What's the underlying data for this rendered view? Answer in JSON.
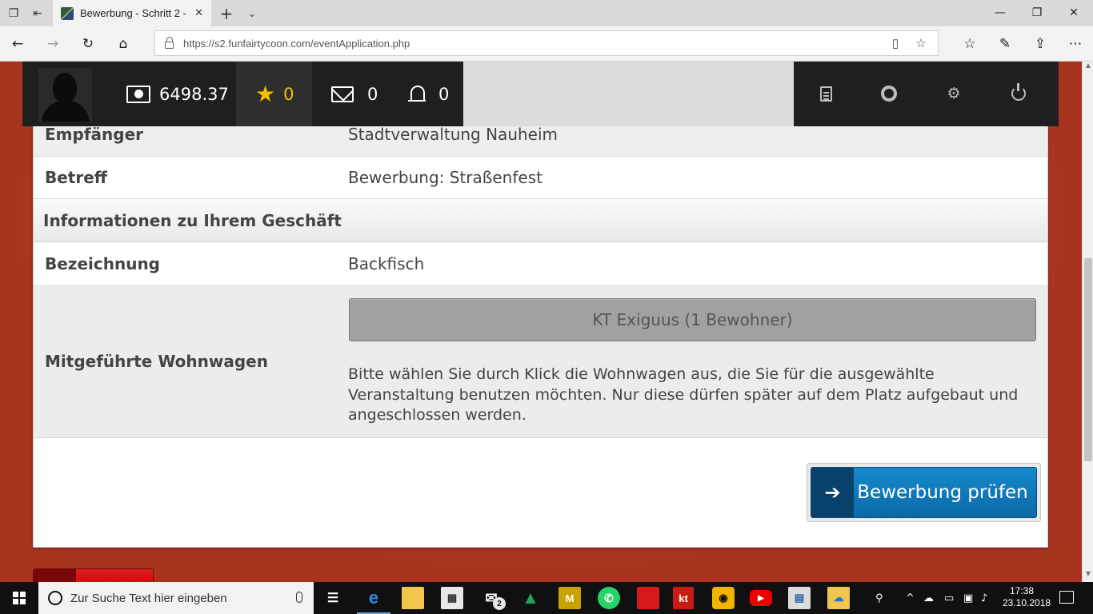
{
  "browser": {
    "tab_title": "Bewerbung - Schritt 2 -",
    "url": "https://s2.funfairtycoon.com/eventApplication.php",
    "icons": [
      "task-view-icon",
      "set-aside-icon",
      "close-icon",
      "new-tab-icon",
      "chevron-down-icon",
      "back-icon",
      "forward-icon",
      "refresh-icon",
      "home-icon",
      "lock-icon",
      "reading-view-icon",
      "favorite-star-icon",
      "favorites-hub-icon",
      "pen-icon",
      "share-icon",
      "more-icon"
    ]
  },
  "window_controls": [
    "minimize-icon",
    "restore-icon",
    "close-icon"
  ],
  "gamebar": {
    "money": "6498.37",
    "favorites": "0",
    "messages": "0",
    "notifications": "0",
    "colors": {
      "bar": "#1f1f1f",
      "favorites_accent": "#f2c200"
    },
    "menu_icons": [
      "document-icon",
      "help-lifebuoy-icon",
      "settings-gears-icon",
      "power-icon"
    ]
  },
  "form": {
    "recipient": {
      "label": "Empfänger",
      "value": "Stadtverwaltung Nauheim"
    },
    "subject": {
      "label": "Betreff",
      "value": "Bewerbung: Straßenfest"
    },
    "section_title": "Informationen zu Ihrem Geschäft",
    "designation": {
      "label": "Bezeichnung",
      "value": "Backfisch"
    },
    "caravans": {
      "label": "Mitgeführte Wohnwagen",
      "option": "KT Exiguus (1 Bewohner)",
      "hint": "Bitte wählen Sie durch Klick die Wohnwagen aus, die Sie für die ausgewählte Veranstaltung benutzen möchten. Nur diese dürfen später auf dem Platz aufgebaut und angeschlossen werden."
    },
    "submit_label": "Bewerbung prüfen",
    "submit_icon": "arrow-right-icon",
    "colors": {
      "submit": "#0f78ba",
      "submit_icon_box": "#08426b",
      "back_button": "#d31212"
    }
  },
  "taskbar": {
    "search_placeholder": "Zur Suche Text hier eingeben",
    "mail_badge": "2",
    "kt_label": "kt",
    "time": "17:38",
    "date": "23.10.2018"
  }
}
